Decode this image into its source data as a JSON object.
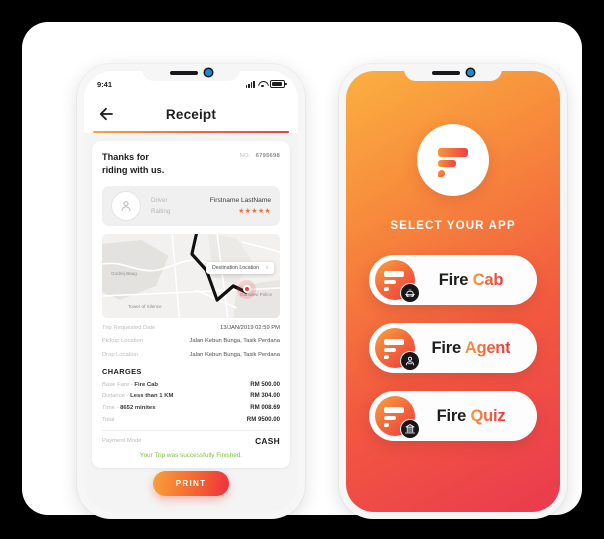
{
  "left_phone": {
    "status_bar": {
      "time": "9:41"
    },
    "header": {
      "title": "Receipt",
      "back_icon": "arrow-left-icon"
    },
    "receipt": {
      "thanks_line1": "Thanks for",
      "thanks_line2": "riding with us.",
      "no_label": "NO.",
      "no_value": "6795698",
      "driver_label": "Driver",
      "driver_name": "Firstname LastName",
      "rating_label": "Raiting",
      "rating_stars": "★★★★★",
      "map": {
        "destination_pill": "Destination Location",
        "chevron": "›",
        "labels": [
          "Godrej Baug",
          "Tower of Silence",
          "Gamdevi Police"
        ]
      },
      "trip_rows": [
        {
          "label": "Trip Requested Date",
          "value": "13/JAN/2019 02:59 PM"
        },
        {
          "label": "Pickup Location",
          "value": "Jalan Kebun Bunga, Tasik Perdana"
        },
        {
          "label": "Drop Location",
          "value": "Jalan Kebun Bunga, Tasik Perdana"
        }
      ],
      "charges_heading": "CHARGES",
      "charges": [
        {
          "label": "Base Fare - ",
          "bold": "Fire Cab",
          "value": "RM 500.00"
        },
        {
          "label": "Distance - ",
          "bold": "Less than 1 KM",
          "value": "RM 304.00"
        },
        {
          "label": "Time - ",
          "bold": "8652 minites",
          "value": "RM 008.69"
        },
        {
          "label": "Total",
          "bold": "",
          "value": "RM 9500.00"
        }
      ],
      "payment_label": "Payment Mode",
      "payment_value": "CASH",
      "finished_note": "Your Trip was successfully Finished."
    },
    "print_button": "PRINT"
  },
  "right_phone": {
    "logo_name": "fire-logo",
    "select_title": "SELECT YOUR APP",
    "apps": [
      {
        "name_plain": "Fire ",
        "name_accent": "Cab",
        "badge_icon": "taxi-icon"
      },
      {
        "name_plain": "Fire ",
        "name_accent": "Agent",
        "badge_icon": "agent-icon"
      },
      {
        "name_plain": "Fire ",
        "name_accent": "Quiz",
        "badge_icon": "building-icon"
      }
    ]
  },
  "colors": {
    "gradient_start": "#fbb040",
    "gradient_end": "#ea3a4f",
    "accent_orange": "#f4702f",
    "success_green": "#7dc242",
    "badge_dark": "#17171a"
  }
}
